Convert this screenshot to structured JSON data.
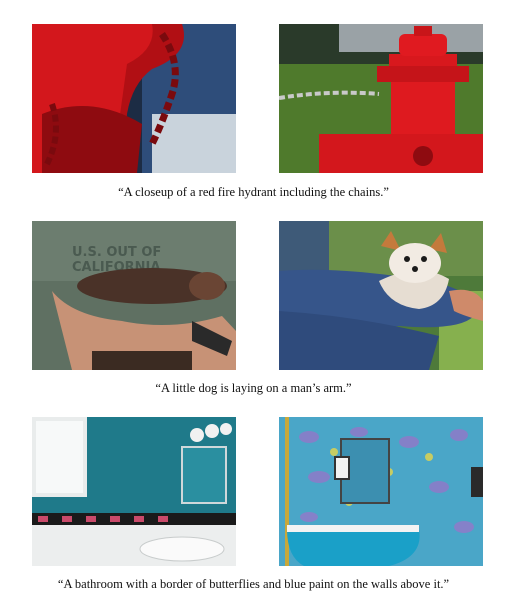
{
  "figure": {
    "rows": [
      {
        "caption": "“A closeup of a red fire hydrant including the chains.”",
        "images": [
          {
            "name": "red-fire-hydrant-closeup-photo"
          },
          {
            "name": "red-fire-hydrant-with-chain-photo"
          }
        ]
      },
      {
        "caption": "“A little dog is laying on a man’s arm.”",
        "images": [
          {
            "name": "chihuahua-on-man-arm-photo"
          },
          {
            "name": "small-dog-on-jeans-arm-photo"
          }
        ]
      },
      {
        "caption": "“A bathroom with a border of butterflies and blue paint on the walls above it.”",
        "images": [
          {
            "name": "blue-bathroom-butterfly-border-photo"
          },
          {
            "name": "butterfly-wallpaper-bathtub-photo"
          }
        ]
      }
    ]
  }
}
